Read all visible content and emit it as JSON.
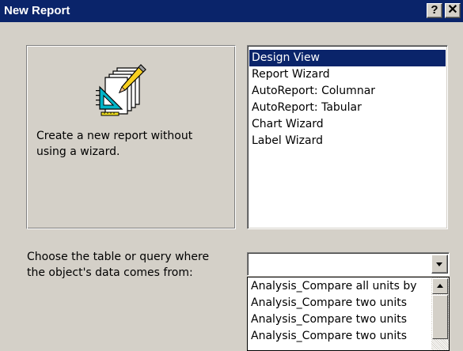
{
  "window": {
    "title": "New Report",
    "help_label": "?",
    "close_label": "✕"
  },
  "preview": {
    "icon": "report-design-icon",
    "description": "Create a new report without\nusing a wizard."
  },
  "report_types": {
    "selected": "Design View",
    "items": [
      {
        "label": "Design View"
      },
      {
        "label": "Report Wizard"
      },
      {
        "label": "AutoReport: Columnar"
      },
      {
        "label": "AutoReport: Tabular"
      },
      {
        "label": "Chart Wizard"
      },
      {
        "label": "Label Wizard"
      }
    ]
  },
  "source": {
    "prompt": "Choose the table or query where\nthe object's data comes from:",
    "value": "",
    "options": [
      {
        "label": "Analysis_Compare all units by"
      },
      {
        "label": "Analysis_Compare two units"
      },
      {
        "label": "Analysis_Compare two units"
      },
      {
        "label": "Analysis_Compare two units"
      }
    ]
  },
  "colors": {
    "title_bar": "#0a246a",
    "face": "#d4d0c8",
    "selection": "#0a246a"
  }
}
